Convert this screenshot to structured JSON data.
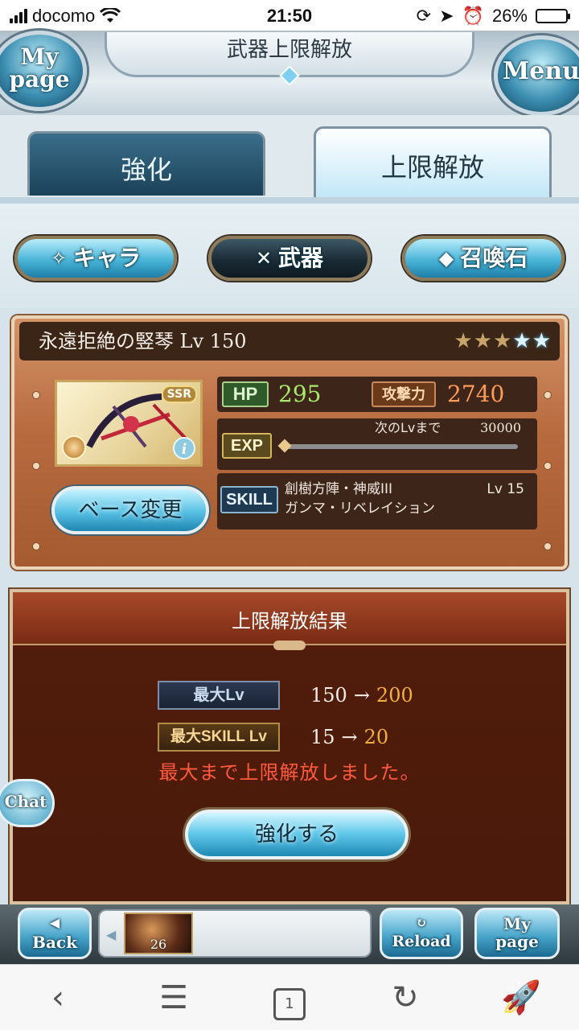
{
  "status_bar": {
    "carrier": "docomo",
    "time": "21:50",
    "battery": "26%",
    "battery_level": 0.26
  },
  "header": {
    "title": "武器上限解放",
    "mypage_label_1": "My",
    "mypage_label_2": "page",
    "menu_label": "Menu"
  },
  "tabs": [
    {
      "label": "強化",
      "active": false
    },
    {
      "label": "上限解放",
      "active": true
    }
  ],
  "categories": [
    {
      "label": "キャラ",
      "icon": "sword-wing-icon"
    },
    {
      "label": "武器",
      "icon": "crossed-swords-icon"
    },
    {
      "label": "召喚石",
      "icon": "crystal-icon"
    }
  ],
  "weapon": {
    "name": "永遠拒絶の竪琴 Lv 150",
    "rarity": "SSR",
    "stars_filled_gold": 3,
    "stars_filled_blue": 2,
    "base_change_label": "ベース変更",
    "hp_tag": "HP",
    "hp": "295",
    "atk_tag": "攻撃力",
    "atk": "2740",
    "exp_tag": "EXP",
    "next_lv_label": "次のLvまで",
    "next_lv_value": "30000",
    "exp_progress": 0,
    "skill_tag": "SKILL",
    "skill_name_1": "創樹方陣・神威III",
    "skill_name_2": "ガンマ・リベレイション",
    "skill_lv": "Lv 15"
  },
  "result": {
    "title": "上限解放結果",
    "rows": [
      {
        "label": "最大Lv",
        "before": "150",
        "arrow": "→",
        "after": "200"
      },
      {
        "label": "最大SKILL Lv",
        "before": "15",
        "arrow": "→",
        "after": "20"
      }
    ],
    "message": "最大まで上限解放しました。",
    "enhance_button": "強化する"
  },
  "chat_label": "Chat",
  "game_bar": {
    "back_label": "Back",
    "queue_count": "26",
    "reload_label": "Reload",
    "mypage_label_1": "My",
    "mypage_label_2": "page"
  },
  "browser_bar": {
    "tab_count": "1"
  },
  "colors": {
    "hp_value": "#a8ea6c",
    "atk_value": "#ff9b57",
    "after_value": "#f2b23a",
    "message": "#ff5a3c"
  }
}
